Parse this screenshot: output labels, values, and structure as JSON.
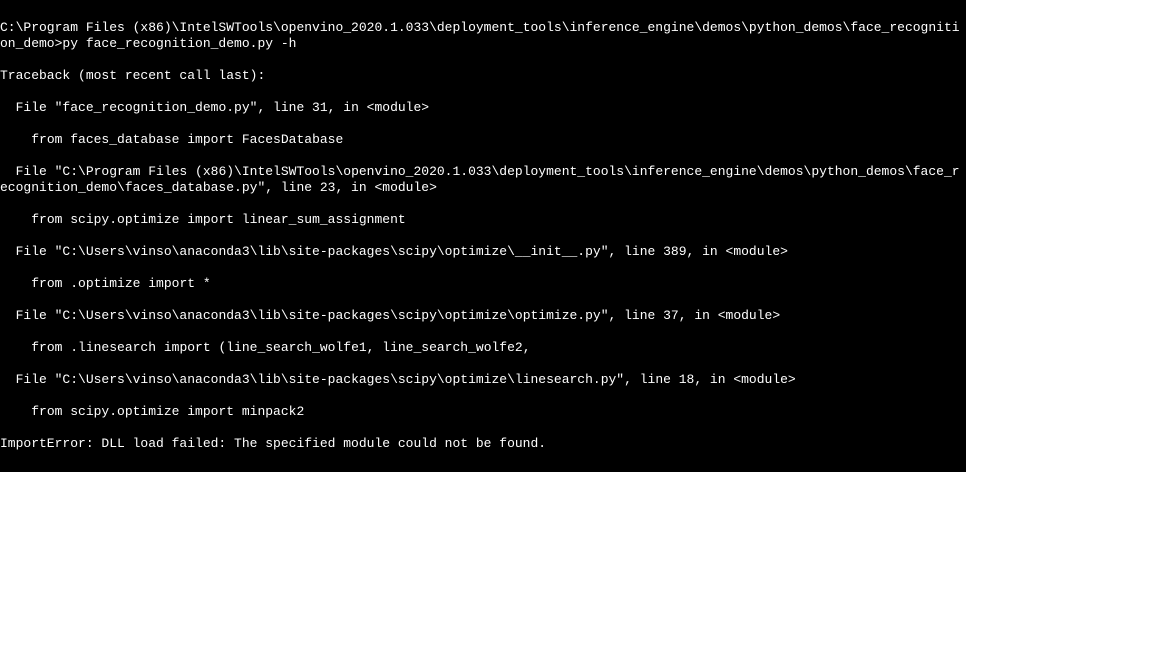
{
  "terminal": {
    "lines": [
      "C:\\Program Files (x86)\\IntelSWTools\\openvino_2020.1.033\\deployment_tools\\inference_engine\\demos\\python_demos\\face_recognition_demo>py face_recognition_demo.py -h",
      "Traceback (most recent call last):",
      "  File \"face_recognition_demo.py\", line 31, in <module>",
      "    from faces_database import FacesDatabase",
      "  File \"C:\\Program Files (x86)\\IntelSWTools\\openvino_2020.1.033\\deployment_tools\\inference_engine\\demos\\python_demos\\face_recognition_demo\\faces_database.py\", line 23, in <module>",
      "    from scipy.optimize import linear_sum_assignment",
      "  File \"C:\\Users\\vinso\\anaconda3\\lib\\site-packages\\scipy\\optimize\\__init__.py\", line 389, in <module>",
      "    from .optimize import *",
      "  File \"C:\\Users\\vinso\\anaconda3\\lib\\site-packages\\scipy\\optimize\\optimize.py\", line 37, in <module>",
      "    from .linesearch import (line_search_wolfe1, line_search_wolfe2,",
      "  File \"C:\\Users\\vinso\\anaconda3\\lib\\site-packages\\scipy\\optimize\\linesearch.py\", line 18, in <module>",
      "    from scipy.optimize import minpack2",
      "ImportError: DLL load failed: The specified module could not be found."
    ]
  },
  "dot": "."
}
